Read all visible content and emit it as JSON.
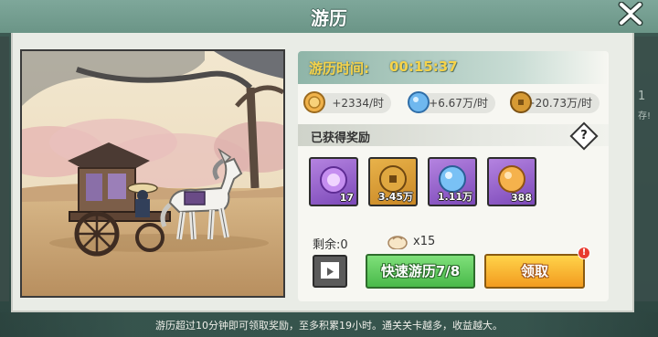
{
  "window": {
    "title": "游历"
  },
  "expedition": {
    "time_label": "游历时间:",
    "time_value": "00:15:37"
  },
  "rates": [
    {
      "icon": "gold-coin-icon",
      "text": "+2334/时"
    },
    {
      "icon": "blue-orb-icon",
      "text": "+6.67万/时"
    },
    {
      "icon": "copper-coin-icon",
      "text": "+20.73万/时"
    }
  ],
  "rewards": {
    "title": "已获得奖励",
    "items": [
      {
        "icon": "purple-orb-icon",
        "count": "17"
      },
      {
        "icon": "copper-coin-icon",
        "count": "3.45万"
      },
      {
        "icon": "blue-orb-icon",
        "count": "1.11万"
      },
      {
        "icon": "gold-orb-icon",
        "count": "388"
      }
    ]
  },
  "remaining": {
    "label": "剩余:0",
    "bun_count": "x15"
  },
  "buttons": {
    "quick": "快速游历7/8",
    "claim": "领取",
    "alert": "!"
  },
  "footer": {
    "note": "游历超过10分钟即可领取奖励，至多积累19小时。通关关卡越多，收益越大。"
  },
  "side_right": {
    "top": "1",
    "bottom": "存!"
  }
}
